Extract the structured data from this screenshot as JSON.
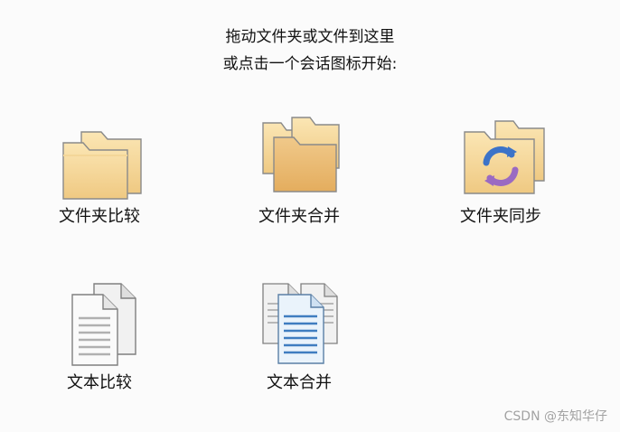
{
  "instructions": {
    "line1": "拖动文件夹或文件到这里",
    "line2": "或点击一个会话图标开始:"
  },
  "tiles": [
    {
      "label": "文件夹比较",
      "icon": "folder-compare-icon"
    },
    {
      "label": "文件夹合并",
      "icon": "folder-merge-icon"
    },
    {
      "label": "文件夹同步",
      "icon": "folder-sync-icon"
    },
    {
      "label": "文本比较",
      "icon": "text-compare-icon"
    },
    {
      "label": "文本合并",
      "icon": "text-merge-icon"
    }
  ],
  "watermark": "CSDN @东知华仔",
  "colors": {
    "folder_light": "#f7dfa4",
    "folder_dark": "#e9b86a",
    "folder_outline": "#8a8a8a",
    "sync_blue": "#3c73c8",
    "sync_purple": "#9a6ac2",
    "doc_blue_lines": "#3f7dc0"
  }
}
